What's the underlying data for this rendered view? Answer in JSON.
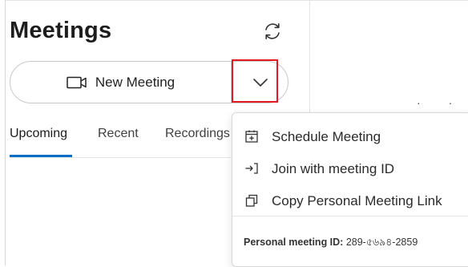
{
  "header": {
    "title": "Meetings"
  },
  "actions": {
    "new_meeting_label": "New Meeting"
  },
  "tabs": [
    {
      "label": "Upcoming",
      "active": true
    },
    {
      "label": "Recent",
      "active": false
    },
    {
      "label": "Recordings",
      "active": false
    }
  ],
  "dropdown_menu": {
    "items": [
      {
        "label": "Schedule Meeting",
        "icon": "calendar-plus-icon"
      },
      {
        "label": "Join with meeting ID",
        "icon": "join-arrow-icon"
      },
      {
        "label": "Copy Personal Meeting Link",
        "icon": "copy-icon"
      }
    ],
    "personal_meeting_id_label": "Personal meeting ID:",
    "personal_meeting_id_value": "289-৫৬৯৪-2859"
  },
  "colors": {
    "accent": "#0a6fc2",
    "highlight": "#e21b23"
  }
}
